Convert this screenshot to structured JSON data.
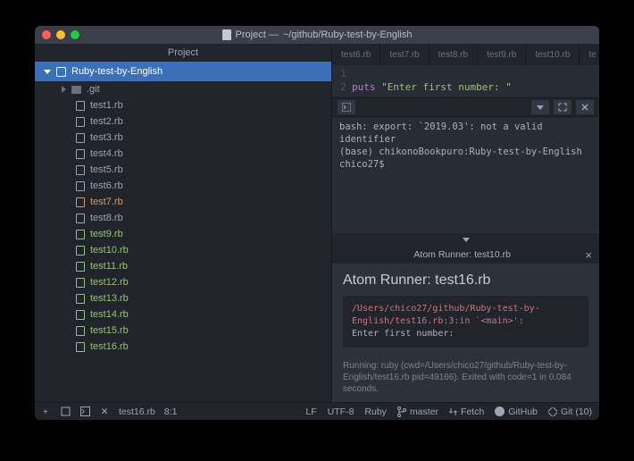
{
  "window_title_prefix": "Project —",
  "window_title_path": "~/github/Ruby-test-by-English",
  "sidebar": {
    "header": "Project",
    "root": "Ruby-test-by-English",
    "git_folder": ".git",
    "files": [
      {
        "name": "test1.rb",
        "cls": ""
      },
      {
        "name": "test2.rb",
        "cls": ""
      },
      {
        "name": "test3.rb",
        "cls": ""
      },
      {
        "name": "test4.rb",
        "cls": ""
      },
      {
        "name": "test5.rb",
        "cls": ""
      },
      {
        "name": "test6.rb",
        "cls": ""
      },
      {
        "name": "test7.rb",
        "cls": "c-orange"
      },
      {
        "name": "test8.rb",
        "cls": ""
      },
      {
        "name": "test9.rb",
        "cls": "c-green"
      },
      {
        "name": "test10.rb",
        "cls": "c-green"
      },
      {
        "name": "test11.rb",
        "cls": "c-green"
      },
      {
        "name": "test12.rb",
        "cls": "c-green"
      },
      {
        "name": "test13.rb",
        "cls": "c-green"
      },
      {
        "name": "test14.rb",
        "cls": "c-green"
      },
      {
        "name": "test15.rb",
        "cls": "c-green"
      },
      {
        "name": "test16.rb",
        "cls": "c-green"
      }
    ]
  },
  "tabs": [
    "test6.rb",
    "test7.rb",
    "test8.rb",
    "test9.rb",
    "test10.rb",
    "te"
  ],
  "code": {
    "line1_no": "1",
    "line2_no": "2",
    "kw": "puts",
    "str": "\"Enter first number: \""
  },
  "terminal": {
    "l1": "bash: export: `2019.03': not a valid identifier",
    "l2": "(base) chikonoBookpuro:Ruby-test-by-English chico27$"
  },
  "runner": {
    "header": "Atom Runner: test10.rb",
    "title": "Atom Runner: test16.rb",
    "err": "/Users/chico27/github/Ruby-test-by-English/test16.rb:3:in `<main>':",
    "out": "Enter first number:",
    "foot": "Running: ruby (cwd=/Users/chico27/github/Ruby-test-by-English/test16.rb pid=49166). Exited with code=1 in 0.084 seconds."
  },
  "status": {
    "file": "test16.rb",
    "pos": "8:1",
    "lf": "LF",
    "enc": "UTF-8",
    "lang": "Ruby",
    "branch": "master",
    "fetch": "Fetch",
    "github": "GitHub",
    "git": "Git (10)"
  }
}
